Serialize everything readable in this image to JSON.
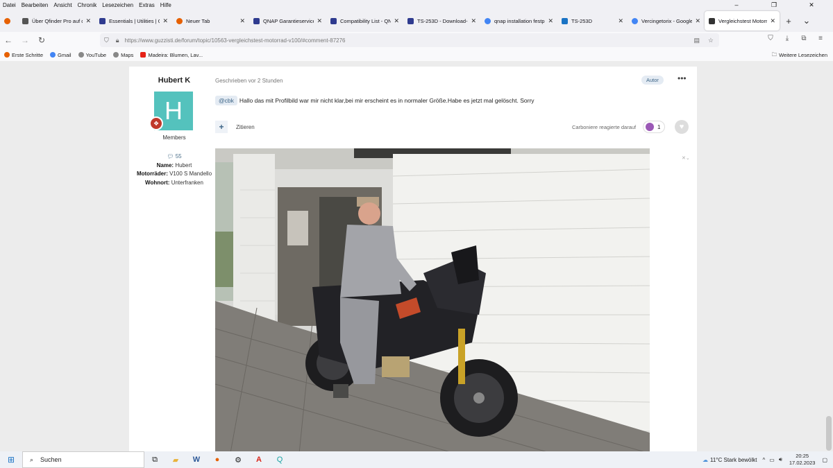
{
  "menu": [
    "Datei",
    "Bearbeiten",
    "Ansicht",
    "Chronik",
    "Lesezeichen",
    "Extras",
    "Hilfe"
  ],
  "tabs": [
    {
      "label": "Über Qfinder Pro auf das N",
      "color": "#555555"
    },
    {
      "label": "Essentials | Utilities | QN",
      "color": "#2f3b8f"
    },
    {
      "label": "Neuer Tab",
      "color": "#e66000"
    },
    {
      "label": "QNAP Garantieservice",
      "color": "#2f3b8f"
    },
    {
      "label": "Compatibility List - QN",
      "color": "#2f3b8f"
    },
    {
      "label": "TS-253D - Download-C",
      "color": "#2f3b8f"
    },
    {
      "label": "qnap installation festpl",
      "color": "#4285f4"
    },
    {
      "label": "TS-253D",
      "color": "#1a73c4"
    },
    {
      "label": "Vercingetorix - Google",
      "color": "#4285f4"
    },
    {
      "label": "Vergleichstest Motorrad",
      "color": "#333333"
    }
  ],
  "url": "https://www.guzzisti.de/forum/topic/10563-vergleichstest-motorrad-v100/#comment-87276",
  "bookmarks": [
    {
      "label": "Erste Schritte",
      "color": "#e66000"
    },
    {
      "label": "Gmail",
      "color": "#4285f4"
    },
    {
      "label": "YouTube",
      "color": "#666666"
    },
    {
      "label": "Maps",
      "color": "#666666"
    },
    {
      "label": "Madeira: Blumen, Lav...",
      "color": "#e62117"
    }
  ],
  "bookmarks_right": "Weitere Lesezeichen",
  "post": {
    "author_name": "Hubert K",
    "avatar_letter": "H",
    "group": "Members",
    "post_count": "55",
    "name_label": "Name:",
    "name_value": "Hubert",
    "bikes_label": "Motorräder:",
    "bikes_value": "V100 S Mandello",
    "home_label": "Wohnort:",
    "home_value": "Unterfranken",
    "meta": "Geschrieben vor 2 Stunden",
    "author_badge": "Autor",
    "mention": "@cbk",
    "text": "Hallo das mit Profilbild war mir nicht klar,bei mir erscheint es in normaler Größe.Habe es jetzt mal gelöscht. Sorry",
    "quote_label": "Zitieren",
    "reacted_label": "Carboniere reagierte darauf",
    "reaction_count": "1"
  },
  "taskbar": {
    "search_label": "Suchen",
    "weather": "11°C  Stark bewölkt",
    "time": "20:25",
    "date": "17.02.2023"
  }
}
